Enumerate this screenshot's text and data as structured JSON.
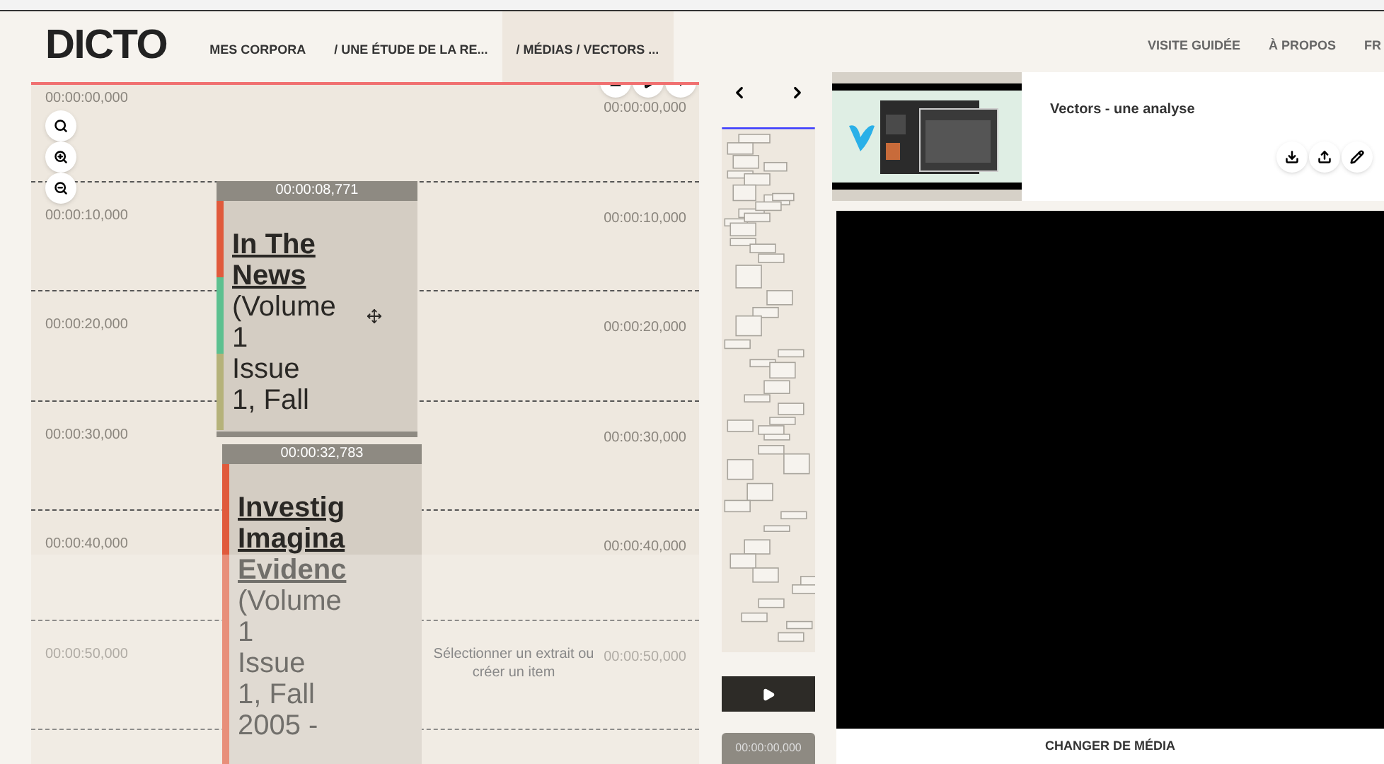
{
  "header": {
    "logo": "DICTO",
    "breadcrumbs": [
      {
        "label": "MES CORPORA",
        "selected": false
      },
      {
        "label": "/ UNE ÉTUDE DE LA RE...",
        "selected": false
      },
      {
        "label": "/ MÉDIAS / VECTORS ...",
        "selected": true
      }
    ],
    "nav": [
      "VISITE GUIDÉE",
      "À PROPOS",
      "FR"
    ]
  },
  "timeline": {
    "ticks": [
      {
        "left": "00:00:00,000",
        "right": "00:00:00,000"
      },
      {
        "left": "00:00:10,000",
        "right": "00:00:10,000"
      },
      {
        "left": "00:00:20,000",
        "right": "00:00:20,000"
      },
      {
        "left": "00:00:30,000",
        "right": "00:00:30,000"
      },
      {
        "left": "00:00:40,000",
        "right": "00:00:40,000"
      },
      {
        "left": "00:00:50,000",
        "right": "00:00:50,000"
      }
    ],
    "annotations": [
      {
        "time": "00:00:08,771",
        "title_lines": [
          "In The",
          "News"
        ],
        "body_lines": [
          "(Volume",
          "1",
          "Issue",
          "1, Fall"
        ],
        "tags": [
          {
            "color": "#e05a3c"
          },
          {
            "color": "#5cc08f"
          },
          {
            "color": "#b5b27a"
          }
        ]
      },
      {
        "time": "00:00:32,783",
        "title_lines": [
          "Investig",
          "Imagina",
          "Evidenc"
        ],
        "body_lines": [
          "(Volume",
          "1",
          "Issue",
          "1, Fall",
          "2005 -"
        ],
        "tags": [
          {
            "color": "#e05a3c"
          }
        ]
      }
    ],
    "empty_message": "Sélectionner un extrait ou créer un item"
  },
  "player": {
    "time": "00:00:00,000"
  },
  "media": {
    "title": "Vectors - une analyse",
    "change_button": "CHANGER DE MÉDIA"
  }
}
